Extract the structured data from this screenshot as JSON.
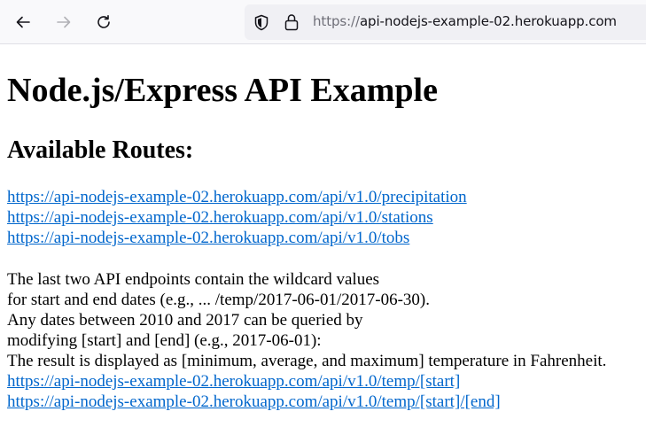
{
  "browser": {
    "url_scheme": "https://",
    "url_host": "api-nodejs-example-02.herokuapp.com"
  },
  "page": {
    "title": "Node.js/Express API Example",
    "subtitle": "Available Routes:",
    "routes": [
      "https://api-nodejs-example-02.herokuapp.com/api/v1.0/precipitation",
      "https://api-nodejs-example-02.herokuapp.com/api/v1.0/stations",
      "https://api-nodejs-example-02.herokuapp.com/api/v1.0/tobs"
    ],
    "description": [
      "The last two API endpoints contain the wildcard values",
      "for start and end dates (e.g., ... /temp/2017-06-01/2017-06-30).",
      "Any dates between 2010 and 2017 can be queried by",
      "modifying [start] and [end] (e.g., 2017-06-01):",
      "The result is displayed as [minimum, average, and maximum] temperature in Fahrenheit."
    ],
    "temp_routes": [
      "https://api-nodejs-example-02.herokuapp.com/api/v1.0/temp/[start]",
      "https://api-nodejs-example-02.herokuapp.com/api/v1.0/temp/[start]/[end]"
    ]
  },
  "colors": {
    "link": "#0066cc",
    "toolbar_bg": "#f9f9fb",
    "urlbar_bg": "#f0f0f4"
  }
}
